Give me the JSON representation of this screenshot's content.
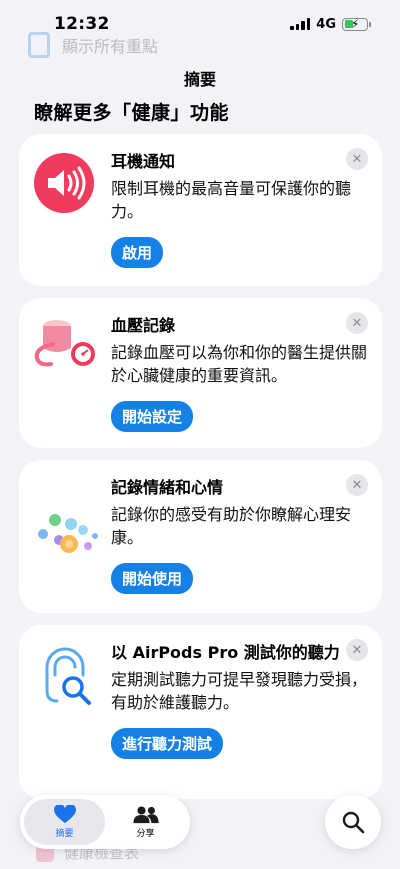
{
  "ghost": {
    "label": "顯示所有重點"
  },
  "status": {
    "time": "12:32",
    "network": "4G"
  },
  "nav": {
    "title": "摘要"
  },
  "section": {
    "title": "瞭解更多「健康」功能"
  },
  "cards": [
    {
      "title": "耳機通知",
      "body": "限制耳機的最高音量可保護你的聽力。",
      "button": "啟用",
      "icon": "headphone-volume-icon"
    },
    {
      "title": "血壓記錄",
      "body": "記錄血壓可以為你和你的醫生提供關於心臟健康的重要資訊。",
      "button": "開始設定",
      "icon": "blood-pressure-icon"
    },
    {
      "title": "記錄情緒和心情",
      "body": "記錄你的感受有助於你瞭解心理安康。",
      "button": "開始使用",
      "icon": "state-of-mind-icon"
    },
    {
      "title": "以 AirPods Pro 測試你的聽力",
      "body": "定期測試聽力可提早發現聽力受損，有助於維護聽力。",
      "button": "進行聽力測試",
      "icon": "hearing-test-icon"
    }
  ],
  "close_symbol": "✕",
  "peek": {
    "label": "健康檢查表"
  },
  "tabbar": {
    "summary_label": "摘要",
    "sharing_label": "分享"
  },
  "colors": {
    "accent": "#1580e6",
    "pink": "#f0506e",
    "background": "#f2f2f7"
  }
}
